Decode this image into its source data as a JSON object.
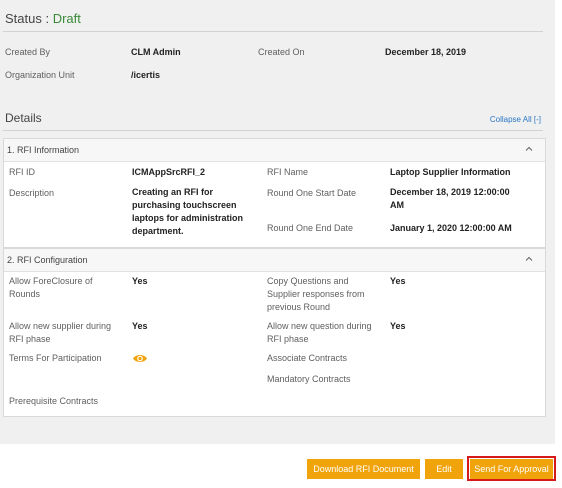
{
  "status": {
    "label": "Status :",
    "value": "Draft"
  },
  "meta": {
    "created_by_label": "Created By",
    "created_by_value": "CLM Admin",
    "created_on_label": "Created On",
    "created_on_value": "December 18, 2019",
    "org_unit_label": "Organization Unit",
    "org_unit_value": "/icertis"
  },
  "details": {
    "title": "Details",
    "collapse_all": "Collapse All [-]"
  },
  "rfi_information": {
    "title": "1. RFI Information",
    "rfi_id_label": "RFI ID",
    "rfi_id_value": "ICMAppSrcRFI_2",
    "rfi_name_label": "RFI Name",
    "rfi_name_value": "Laptop Supplier Information",
    "description_label": "Description",
    "description_value": "Creating an RFI for purchasing touchscreen laptops for administration department.",
    "round_one_start_label": "Round One Start Date",
    "round_one_start_value": "December 18, 2019 12:00:00 AM",
    "round_one_end_label": "Round One End Date",
    "round_one_end_value": "January 1, 2020 12:00:00 AM"
  },
  "rfi_configuration": {
    "title": "2. RFI Configuration",
    "allow_foreclosure_label": "Allow ForeClosure of Rounds",
    "allow_foreclosure_value": "Yes",
    "copy_questions_label": "Copy Questions and Supplier responses from previous Round",
    "copy_questions_value": "Yes",
    "allow_new_supplier_label": "Allow new supplier during RFI phase",
    "allow_new_supplier_value": "Yes",
    "allow_new_question_label": "Allow new question during RFI phase",
    "allow_new_question_value": "Yes",
    "terms_label": "Terms For Participation",
    "associate_contracts_label": "Associate Contracts",
    "mandatory_contracts_label": "Mandatory Contracts",
    "prerequisite_contracts_label": "Prerequisite Contracts"
  },
  "actions": {
    "download_label": "Download RFI Document",
    "edit_label": "Edit",
    "send_label": "Send For Approval"
  },
  "icons": {
    "section_toggle": "chevron-up-icon",
    "terms_view": "eye-icon"
  },
  "colors": {
    "accent": "#f0a30a",
    "status_draft": "#3a8a3a",
    "link": "#2a78c6",
    "highlight": "#d61a1a"
  }
}
